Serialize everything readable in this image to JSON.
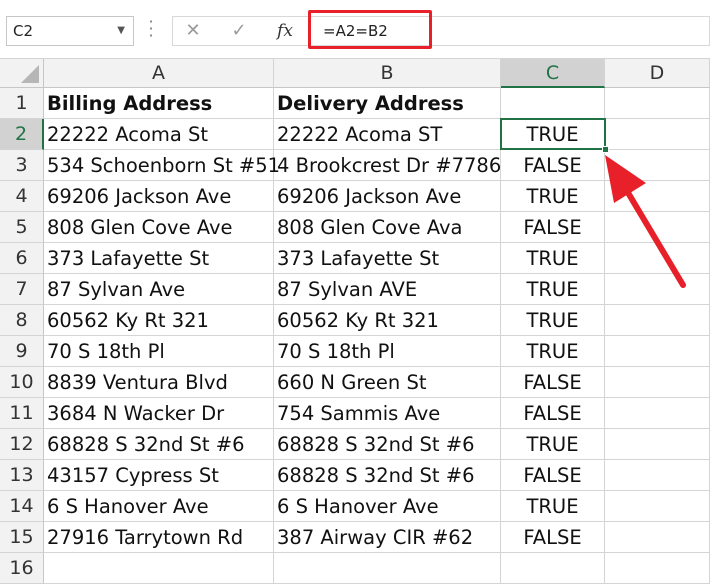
{
  "formula_bar": {
    "name_box": "C2",
    "formula": "=A2=B2",
    "fx_label": "fx",
    "cancel_glyph": "✕",
    "enter_glyph": "✓"
  },
  "columns": [
    "A",
    "B",
    "C",
    "D"
  ],
  "selected_column": "C",
  "selected_row": "2",
  "accent_color": "#217346",
  "highlight_color": "#e8202a",
  "rows": [
    {
      "num": "1",
      "a": "Billing Address",
      "b": "Delivery Address",
      "c": ""
    },
    {
      "num": "2",
      "a": "22222 Acoma St",
      "b": "22222 Acoma ST",
      "c": "TRUE"
    },
    {
      "num": "3",
      "a": "534 Schoenborn St #51",
      "b": "4 Brookcrest Dr #7786",
      "c": "FALSE"
    },
    {
      "num": "4",
      "a": "69206 Jackson Ave",
      "b": "69206 Jackson Ave",
      "c": "TRUE"
    },
    {
      "num": "5",
      "a": "808 Glen Cove Ave",
      "b": "808 Glen Cove Ava",
      "c": "FALSE"
    },
    {
      "num": "6",
      "a": "373 Lafayette St",
      "b": "373 Lafayette St",
      "c": "TRUE"
    },
    {
      "num": "7",
      "a": "87 Sylvan Ave",
      "b": "87 Sylvan AVE",
      "c": "TRUE"
    },
    {
      "num": "8",
      "a": "60562 Ky Rt 321",
      "b": "60562 Ky Rt 321",
      "c": "TRUE"
    },
    {
      "num": "9",
      "a": "70 S 18th Pl",
      "b": "70 S 18th Pl",
      "c": "TRUE"
    },
    {
      "num": "10",
      "a": "8839 Ventura Blvd",
      "b": "660 N Green St",
      "c": "FALSE"
    },
    {
      "num": "11",
      "a": "3684 N Wacker Dr",
      "b": "754 Sammis Ave",
      "c": "FALSE"
    },
    {
      "num": "12",
      "a": "68828 S 32nd St #6",
      "b": "68828 S 32nd St #6",
      "c": "TRUE"
    },
    {
      "num": "13",
      "a": "43157 Cypress St",
      "b": "68828 S 32nd St #6",
      "c": "FALSE"
    },
    {
      "num": "14",
      "a": "6 S Hanover Ave",
      "b": "6 S Hanover Ave",
      "c": "TRUE"
    },
    {
      "num": "15",
      "a": "27916 Tarrytown Rd",
      "b": "387 Airway CIR #62",
      "c": "FALSE"
    },
    {
      "num": "16",
      "a": "",
      "b": "",
      "c": ""
    }
  ]
}
